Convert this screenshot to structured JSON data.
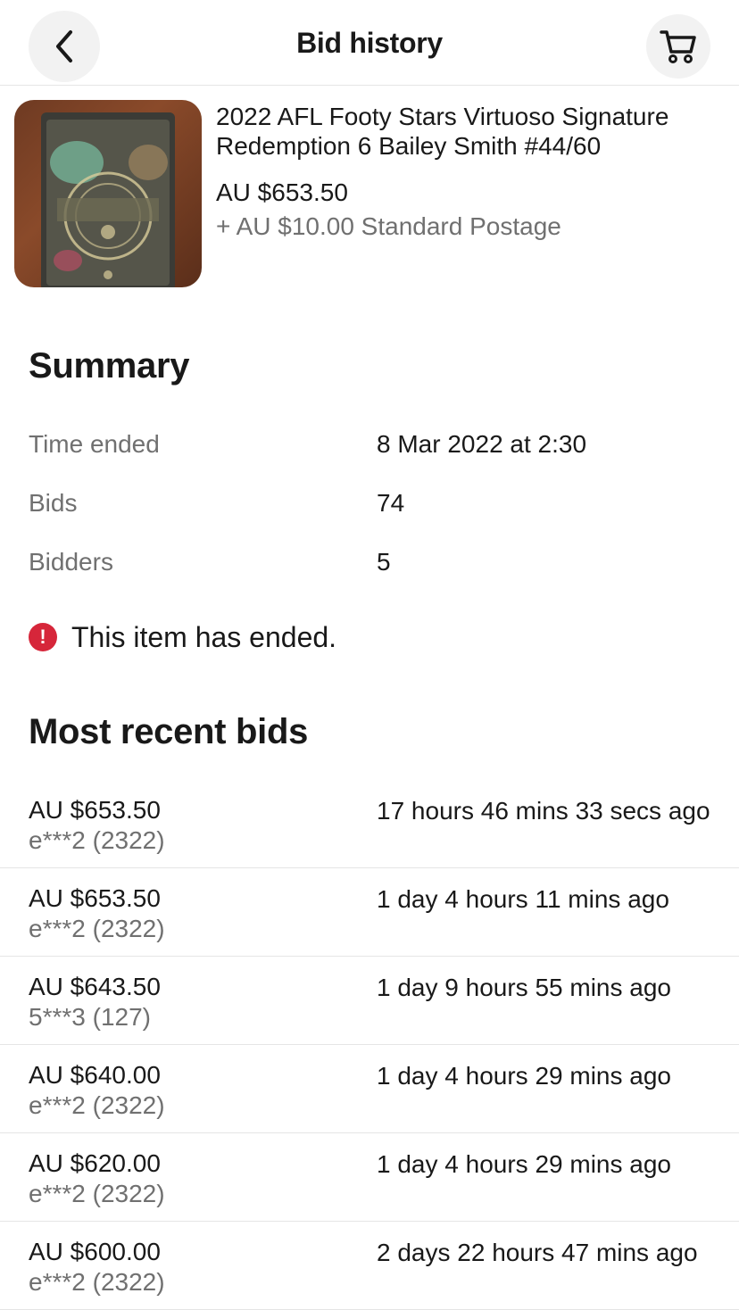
{
  "header": {
    "title": "Bid history",
    "back_icon": "chevron-left-icon",
    "cart_icon": "cart-icon"
  },
  "item": {
    "title": "2022 AFL Footy Stars Virtuoso Signature Redemption 6 Bailey Smith #44/60",
    "price": "AU $653.50",
    "postage": "+ AU $10.00 Standard Postage"
  },
  "summary": {
    "heading": "Summary",
    "rows": [
      {
        "label": "Time ended",
        "value": "8 Mar 2022 at 2:30"
      },
      {
        "label": "Bids",
        "value": "74"
      },
      {
        "label": "Bidders",
        "value": "5"
      }
    ],
    "alert_icon": "!",
    "alert_text": "This item has ended."
  },
  "bids": {
    "heading": "Most recent bids",
    "rows": [
      {
        "amount": "AU $653.50",
        "bidder": "e***2 (2322)",
        "time": "17 hours 46 mins 33 secs ago"
      },
      {
        "amount": "AU $653.50",
        "bidder": "e***2 (2322)",
        "time": "1 day 4 hours 11 mins ago"
      },
      {
        "amount": "AU $643.50",
        "bidder": "5***3 (127)",
        "time": "1 day 9 hours 55 mins ago"
      },
      {
        "amount": "AU $640.00",
        "bidder": "e***2 (2322)",
        "time": "1 day 4 hours 29 mins ago"
      },
      {
        "amount": "AU $620.00",
        "bidder": "e***2 (2322)",
        "time": "1 day 4 hours 29 mins ago"
      },
      {
        "amount": "AU $600.00",
        "bidder": "e***2 (2322)",
        "time": "2 days 22 hours 47 mins ago"
      }
    ]
  },
  "colors": {
    "alert": "#d6263a",
    "secondary_text": "#707070",
    "divider": "#e5e5e5"
  }
}
